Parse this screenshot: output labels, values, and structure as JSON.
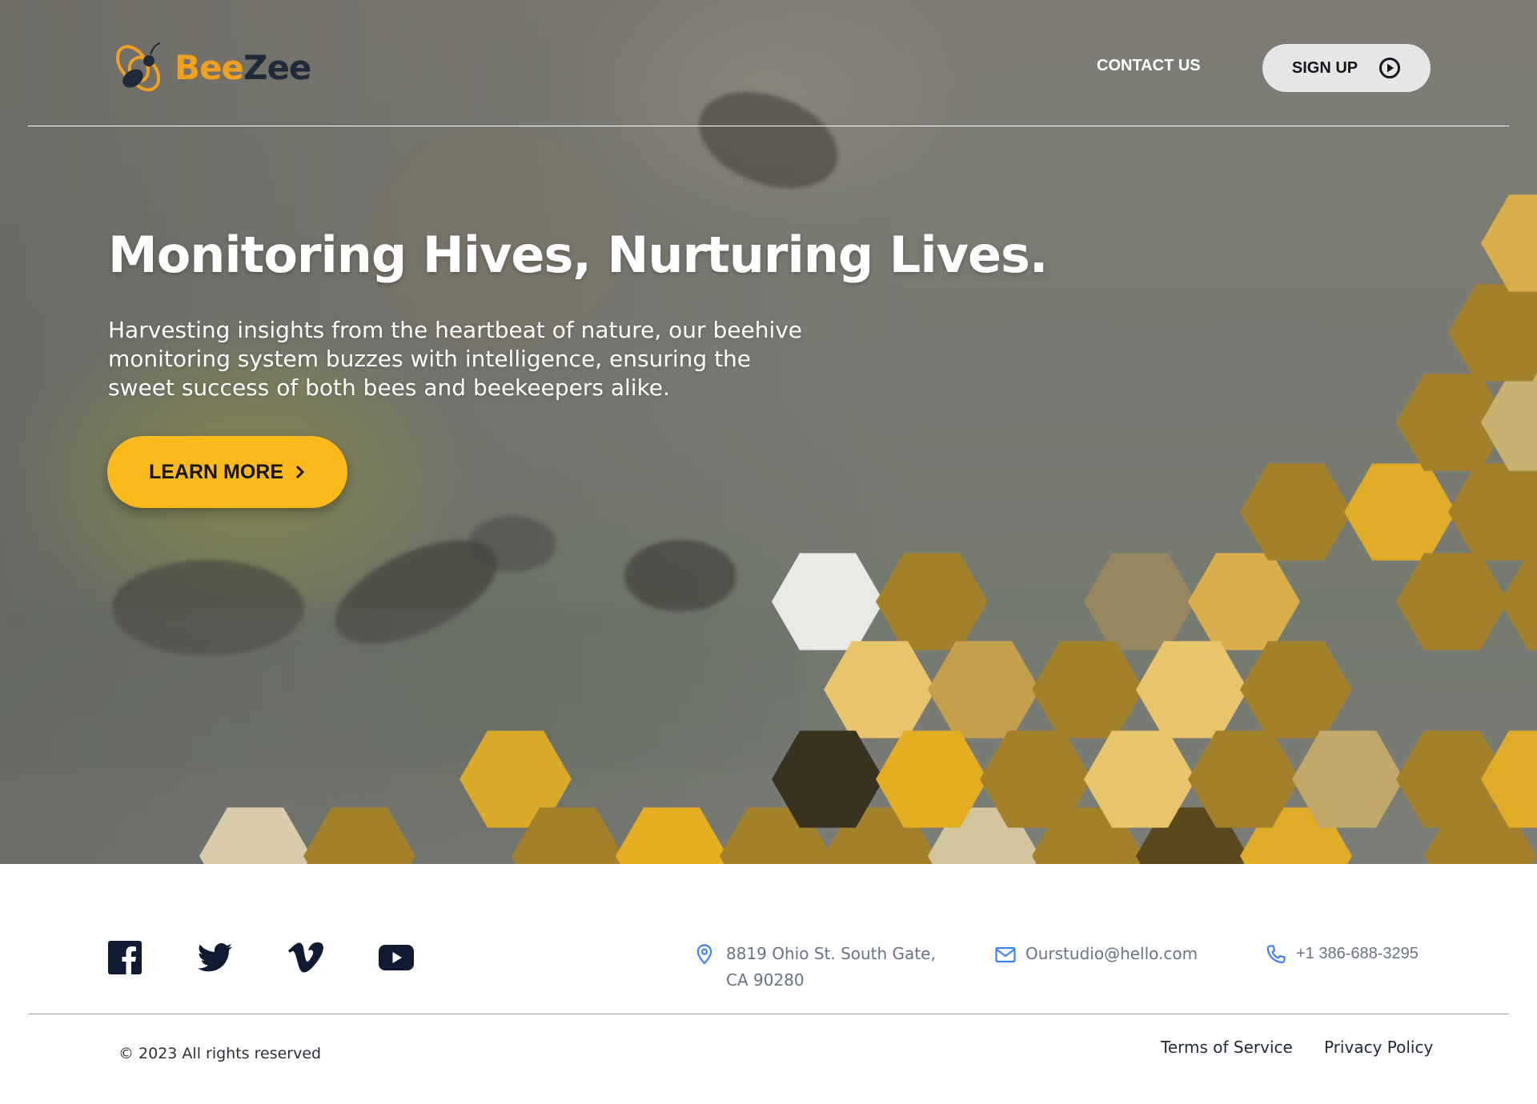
{
  "brand": {
    "name_part1": "Bee",
    "name_part2": "Zee",
    "primary_color": "#f0a01e",
    "dark_color": "#1f2a3a"
  },
  "nav": {
    "contact_label": "CONTACT US",
    "signup_label": "SIGN UP",
    "signup_icon": "play-circle-icon"
  },
  "hero": {
    "title": "Monitoring Hives, Nurturing Lives.",
    "subtitle": "Harvesting insights from the heartbeat of nature, our beehive monitoring system buzzes with intelligence, ensuring the sweet success of both bees and beekeepers alike.",
    "cta_label": "LEARN MORE",
    "cta_icon": "chevron-right-icon",
    "cta_color": "#fbb91c"
  },
  "footer": {
    "social": [
      {
        "name": "facebook-icon"
      },
      {
        "name": "twitter-icon"
      },
      {
        "name": "vimeo-icon"
      },
      {
        "name": "youtube-icon"
      }
    ],
    "address": "8819 Ohio St. South Gate, CA 90280",
    "email": "Ourstudio@hello.com",
    "phone": "+1 386-688-3295",
    "contact_icon_color": "#3b82f6",
    "copyright": "© 2023 All rights reserved",
    "terms_label": "Terms of Service",
    "privacy_label": "Privacy Policy"
  }
}
